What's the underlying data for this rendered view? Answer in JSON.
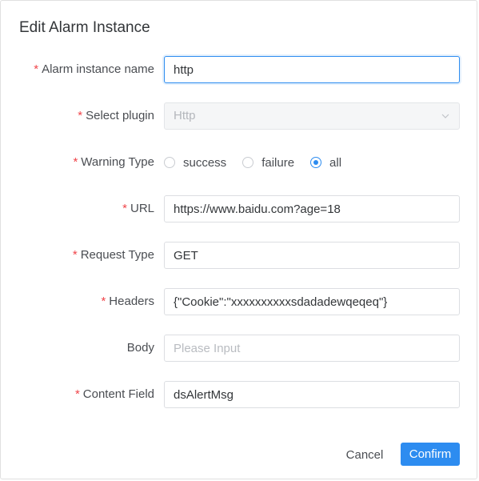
{
  "dialog": {
    "title": "Edit Alarm Instance"
  },
  "form": {
    "required_mark": "*",
    "alarm_instance_name": {
      "label": "Alarm instance name",
      "value": "http"
    },
    "select_plugin": {
      "label": "Select plugin",
      "value": "Http"
    },
    "warning_type": {
      "label": "Warning Type",
      "options": [
        "success",
        "failure",
        "all"
      ],
      "selected": "all"
    },
    "url": {
      "label": "URL",
      "value": "https://www.baidu.com?age=18"
    },
    "request_type": {
      "label": "Request Type",
      "value": "GET"
    },
    "headers": {
      "label": "Headers",
      "value": "{\"Cookie\":\"xxxxxxxxxxsdadadewqeqeq\"}"
    },
    "body": {
      "label": "Body",
      "value": "",
      "placeholder": "Please Input"
    },
    "content_field": {
      "label": "Content Field",
      "value": "dsAlertMsg"
    }
  },
  "footer": {
    "cancel_label": "Cancel",
    "confirm_label": "Confirm"
  },
  "colors": {
    "accent": "#2d8cf0",
    "required": "#f0454a"
  }
}
